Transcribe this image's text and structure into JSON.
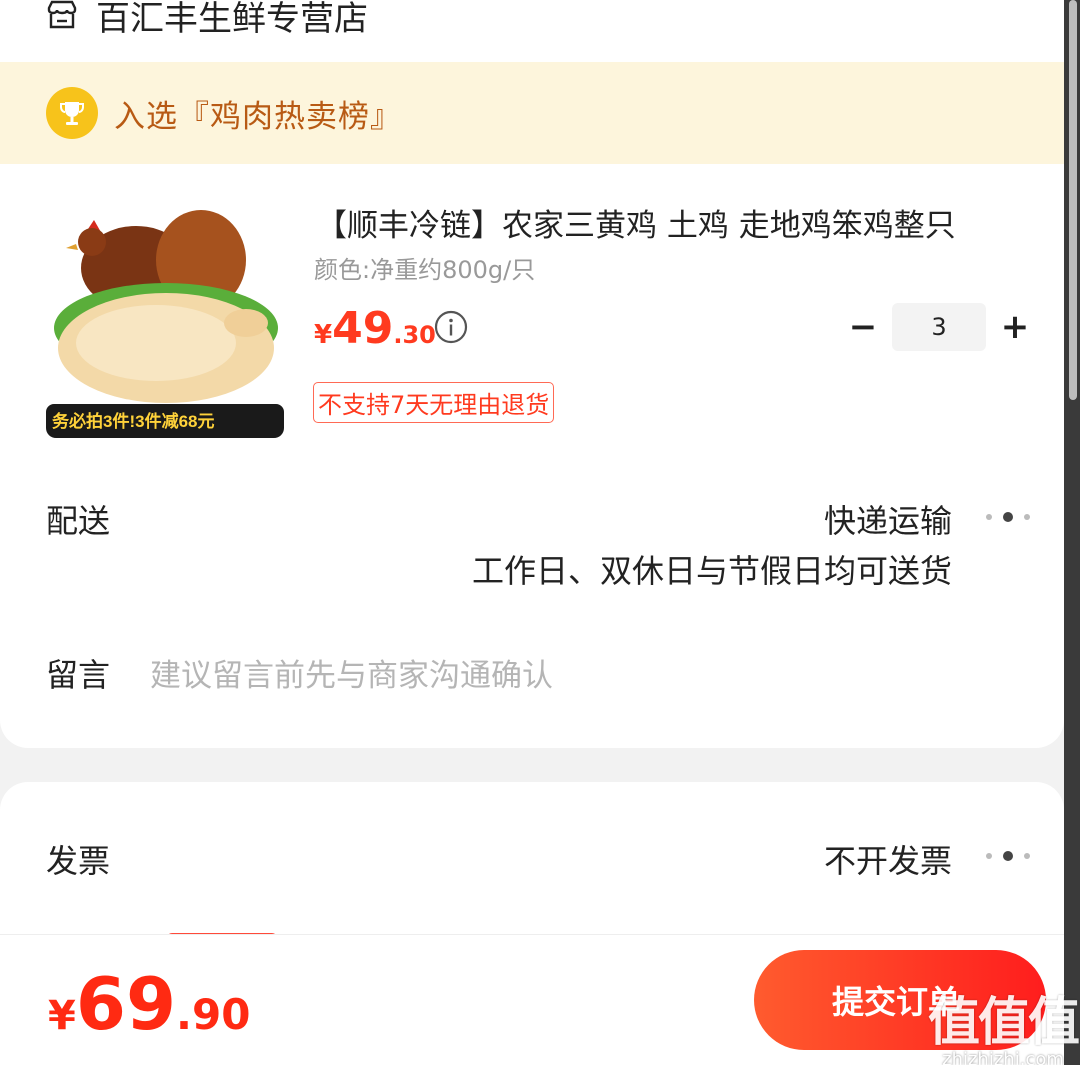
{
  "store": {
    "name": "百汇丰生鲜专营店",
    "icon": "store-icon"
  },
  "banner": {
    "text": "入选『鸡肉热卖榜』",
    "icon": "trophy-icon"
  },
  "product": {
    "title": "【顺丰冷链】农家三黄鸡 土鸡 走地鸡笨鸡整只",
    "spec": "颜色:净重约800g/只",
    "price_currency": "¥",
    "price_int": "49",
    "price_dec": ".30",
    "image_promo": "务必拍3件!3件减68元",
    "quantity": "3",
    "qty_minus": "−",
    "qty_plus": "+",
    "return_policy": "不支持7天无理由退货"
  },
  "delivery": {
    "label": "配送",
    "method": "快递运输",
    "note": "工作日、双休日与节假日均可送货"
  },
  "remark": {
    "label": "留言",
    "placeholder": "建议留言前先与商家沟通确认"
  },
  "invoice": {
    "label": "发票",
    "value": "不开发票"
  },
  "footer": {
    "total_currency": "¥",
    "total_int": "69",
    "total_dec": ".90",
    "submit_label": "提交订单"
  },
  "watermark": {
    "mark": "值值值",
    "text": "zhizhizhi.com"
  },
  "colors": {
    "accent": "#ff2a12",
    "banner_bg": "#fdf5dc",
    "banner_text": "#b85a14",
    "trophy": "#f7c31b"
  }
}
